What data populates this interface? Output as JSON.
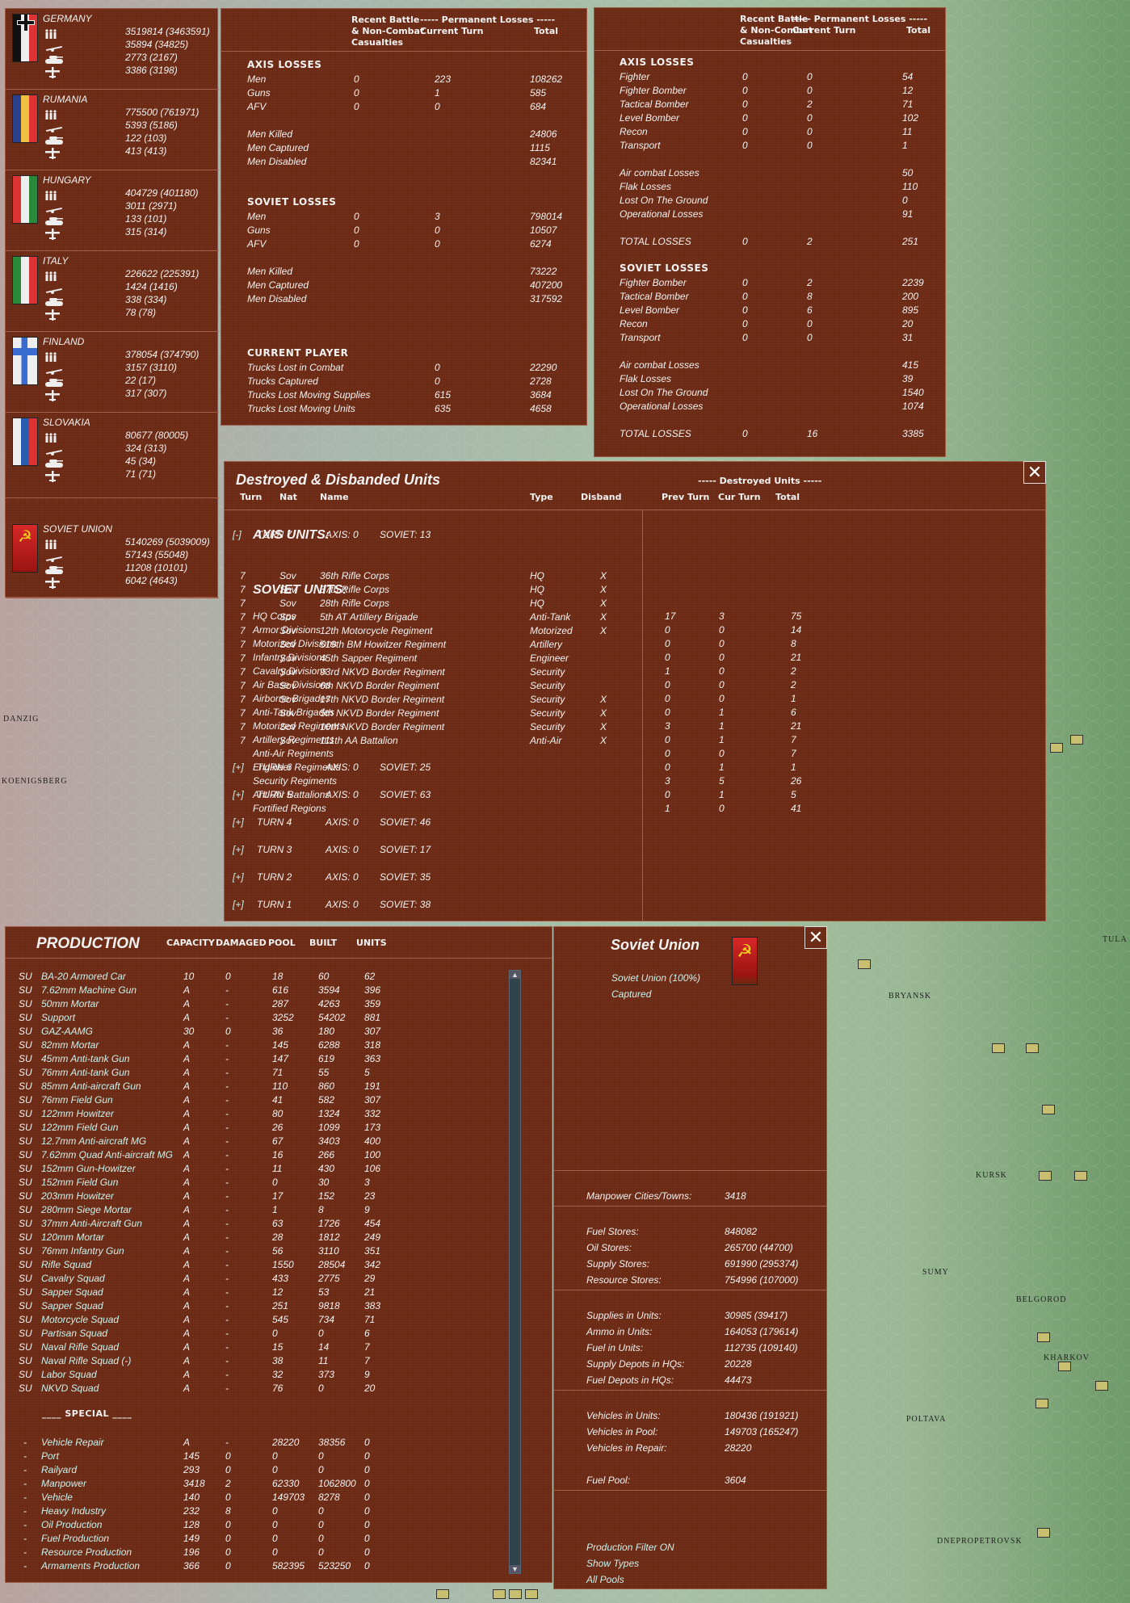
{
  "map_labels": [
    "DANZIG",
    "KOENIGSBERG",
    "BRYANSK",
    "KURSK",
    "SUMY",
    "BELGOROD",
    "KHARKOV",
    "POLTAVA",
    "DNEPROPETROVSK",
    "TULA"
  ],
  "nations": [
    {
      "name": "GERMANY",
      "flag": "germany",
      "men": "3519814 (3463591)",
      "guns": "35894 (34825)",
      "afv": "2773 (2167)",
      "air": "3386 (3198)"
    },
    {
      "name": "RUMANIA",
      "flag": "rumania",
      "men": "775500 (761971)",
      "guns": "5393 (5186)",
      "afv": "122 (103)",
      "air": "413 (413)"
    },
    {
      "name": "HUNGARY",
      "flag": "hungary",
      "men": "404729 (401180)",
      "guns": "3011 (2971)",
      "afv": "133 (101)",
      "air": "315 (314)"
    },
    {
      "name": "ITALY",
      "flag": "italy",
      "men": "226622 (225391)",
      "guns": "1424 (1416)",
      "afv": "338 (334)",
      "air": "78 (78)"
    },
    {
      "name": "FINLAND",
      "flag": "finland",
      "men": "378054 (374790)",
      "guns": "3157 (3110)",
      "afv": "22 (17)",
      "air": "317 (307)"
    },
    {
      "name": "SLOVAKIA",
      "flag": "slovakia",
      "men": "80677 (80005)",
      "guns": "324 (313)",
      "afv": "45 (34)",
      "air": "71 (71)"
    },
    {
      "name": "SOVIET UNION",
      "flag": "soviet",
      "men": "5140269 (5039009)",
      "guns": "57143 (55048)",
      "afv": "11208 (10101)",
      "air": "6042 (4643)"
    }
  ],
  "loss_headers": {
    "recent1": "Recent Battle",
    "recent2": "& Non-Combat",
    "recent3": "Casualties",
    "perm": "----- Permanent Losses -----",
    "cur": "Current Turn",
    "total": "Total"
  },
  "ground_losses": [
    {
      "title": "AXIS LOSSES",
      "groups": [
        [
          [
            "Men",
            "0",
            "223",
            "108262"
          ],
          [
            "Guns",
            "0",
            "1",
            "585"
          ],
          [
            "AFV",
            "0",
            "0",
            "684"
          ]
        ],
        [
          [
            "Men Killed",
            "",
            "",
            "24806"
          ],
          [
            "Men Captured",
            "",
            "",
            "1115"
          ],
          [
            "Men Disabled",
            "",
            "",
            "82341"
          ]
        ]
      ]
    },
    {
      "title": "SOVIET LOSSES",
      "groups": [
        [
          [
            "Men",
            "0",
            "3",
            "798014"
          ],
          [
            "Guns",
            "0",
            "0",
            "10507"
          ],
          [
            "AFV",
            "0",
            "0",
            "6274"
          ]
        ],
        [
          [
            "Men Killed",
            "",
            "",
            "73222"
          ],
          [
            "Men Captured",
            "",
            "",
            "407200"
          ],
          [
            "Men Disabled",
            "",
            "",
            "317592"
          ]
        ]
      ]
    },
    {
      "title": "CURRENT PLAYER",
      "groups": [
        [
          [
            "Trucks Lost in Combat",
            "",
            "0",
            "22290"
          ],
          [
            "Trucks Captured",
            "",
            "0",
            "2728"
          ],
          [
            "Trucks Lost Moving Supplies",
            "",
            "615",
            "3684"
          ],
          [
            "Trucks Lost Moving Units",
            "",
            "635",
            "4658"
          ]
        ]
      ]
    }
  ],
  "air_losses": [
    {
      "title": "AXIS LOSSES",
      "groups": [
        [
          [
            "Fighter",
            "0",
            "0",
            "54"
          ],
          [
            "Fighter Bomber",
            "0",
            "0",
            "12"
          ],
          [
            "Tactical Bomber",
            "0",
            "2",
            "71"
          ],
          [
            "Level Bomber",
            "0",
            "0",
            "102"
          ],
          [
            "Recon",
            "0",
            "0",
            "11"
          ],
          [
            "Transport",
            "0",
            "0",
            "1"
          ]
        ],
        [
          [
            "Air combat Losses",
            "",
            "",
            "50"
          ],
          [
            "Flak Losses",
            "",
            "",
            "110"
          ],
          [
            "Lost On The Ground",
            "",
            "",
            "0"
          ],
          [
            "Operational Losses",
            "",
            "",
            "91"
          ]
        ],
        [
          [
            "TOTAL LOSSES",
            "0",
            "2",
            "251"
          ]
        ]
      ]
    },
    {
      "title": "SOVIET LOSSES",
      "groups": [
        [
          [
            "Fighter Bomber",
            "0",
            "2",
            "2239"
          ],
          [
            "Tactical Bomber",
            "0",
            "8",
            "200"
          ],
          [
            "Level Bomber",
            "0",
            "6",
            "895"
          ],
          [
            "Recon",
            "0",
            "0",
            "20"
          ],
          [
            "Transport",
            "0",
            "0",
            "31"
          ]
        ],
        [
          [
            "Air combat Losses",
            "",
            "",
            "415"
          ],
          [
            "Flak Losses",
            "",
            "",
            "39"
          ],
          [
            "Lost On The Ground",
            "",
            "",
            "1540"
          ],
          [
            "Operational Losses",
            "",
            "",
            "1074"
          ]
        ],
        [
          [
            "TOTAL LOSSES",
            "0",
            "16",
            "3385"
          ]
        ]
      ]
    }
  ],
  "destroyed": {
    "title": "Destroyed & Disbanded Units",
    "close": "✕",
    "headers": [
      "Turn",
      "Nat",
      "Name",
      "Type",
      "Disband"
    ],
    "expanded": {
      "toggle": "[-]",
      "turn": "TURN 7",
      "axis": "AXIS: 0",
      "soviet": "SOVIET: 13"
    },
    "units": [
      [
        "7",
        "Sov",
        "36th Rifle Corps",
        "HQ",
        "X"
      ],
      [
        "7",
        "Sov",
        "37th Rifle Corps",
        "HQ",
        "X"
      ],
      [
        "7",
        "Sov",
        "28th Rifle Corps",
        "HQ",
        "X"
      ],
      [
        "7",
        "Sov",
        "5th AT Artillery Brigade",
        "Anti-Tank",
        "X"
      ],
      [
        "7",
        "Sov",
        "12th Motorcycle Regiment",
        "Motorized",
        "X"
      ],
      [
        "7",
        "Sov",
        "519th BM Howitzer Regiment",
        "Artillery",
        ""
      ],
      [
        "7",
        "Sov",
        "45th Sapper Regiment",
        "Engineer",
        ""
      ],
      [
        "7",
        "Sov",
        "93rd NKVD Border Regiment",
        "Security",
        ""
      ],
      [
        "7",
        "Sov",
        "6th NKVD Border Regiment",
        "Security",
        ""
      ],
      [
        "7",
        "Sov",
        "17th NKVD Border Regiment",
        "Security",
        "X"
      ],
      [
        "7",
        "Sov",
        "5th NKVD Border Regiment",
        "Security",
        "X"
      ],
      [
        "7",
        "Sov",
        "10th NKVD Border Regiment",
        "Security",
        "X"
      ],
      [
        "7",
        "Sov",
        "111th AA Battalion",
        "Anti-Air",
        "X"
      ]
    ],
    "collapsed": [
      {
        "toggle": "[+]",
        "turn": "TURN 6",
        "axis": "AXIS: 0",
        "soviet": "SOVIET: 25"
      },
      {
        "toggle": "[+]",
        "turn": "TURN 5",
        "axis": "AXIS: 0",
        "soviet": "SOVIET: 63"
      },
      {
        "toggle": "[+]",
        "turn": "TURN 4",
        "axis": "AXIS: 0",
        "soviet": "SOVIET: 46"
      },
      {
        "toggle": "[+]",
        "turn": "TURN 3",
        "axis": "AXIS: 0",
        "soviet": "SOVIET: 17"
      },
      {
        "toggle": "[+]",
        "turn": "TURN 2",
        "axis": "AXIS: 0",
        "soviet": "SOVIET: 35"
      },
      {
        "toggle": "[+]",
        "turn": "TURN 1",
        "axis": "AXIS: 0",
        "soviet": "SOVIET: 38"
      }
    ],
    "summary_header": "----- Destroyed Units -----",
    "summary_cols": [
      "Prev Turn",
      "Cur Turn",
      "Total"
    ],
    "axis_title": "AXIS UNITS:",
    "soviet_title": "SOVIET UNITS:",
    "soviet_rows": [
      [
        "HQ Corps",
        "17",
        "3",
        "75"
      ],
      [
        "Armor Divisions",
        "0",
        "0",
        "14"
      ],
      [
        "Motorized Divisions",
        "0",
        "0",
        "8"
      ],
      [
        "Infantry Divisions",
        "0",
        "0",
        "21"
      ],
      [
        "Cavalry Divisions",
        "1",
        "0",
        "2"
      ],
      [
        "Air Base Divisions",
        "0",
        "0",
        "2"
      ],
      [
        "Airborne Brigades",
        "0",
        "0",
        "1"
      ],
      [
        "Anti-Tank Brigades",
        "0",
        "1",
        "6"
      ],
      [
        "Motorized Regiments",
        "3",
        "1",
        "21"
      ],
      [
        "Artillery Regiments",
        "0",
        "1",
        "7"
      ],
      [
        "Anti-Air Regiments",
        "0",
        "0",
        "7"
      ],
      [
        "Engineer Regiments",
        "0",
        "1",
        "1"
      ],
      [
        "Security Regiments",
        "3",
        "5",
        "26"
      ],
      [
        "Anti-Air Battalions",
        "0",
        "1",
        "5"
      ],
      [
        "Fortified Regions",
        "1",
        "0",
        "41"
      ]
    ]
  },
  "production": {
    "title": "PRODUCTION",
    "headers": [
      "CAPACITY",
      "DAMAGED",
      "POOL",
      "BUILT",
      "UNITS"
    ],
    "rows": [
      [
        "SU",
        "BA-20 Armored Car",
        "10",
        "0",
        "18",
        "60",
        "62"
      ],
      [
        "SU",
        "7.62mm Machine Gun",
        "A",
        "-",
        "616",
        "3594",
        "396"
      ],
      [
        "SU",
        "50mm Mortar",
        "A",
        "-",
        "287",
        "4263",
        "359"
      ],
      [
        "SU",
        "Support",
        "A",
        "-",
        "3252",
        "54202",
        "881"
      ],
      [
        "SU",
        "GAZ-AAMG",
        "30",
        "0",
        "36",
        "180",
        "307"
      ],
      [
        "SU",
        "82mm Mortar",
        "A",
        "-",
        "145",
        "6288",
        "318"
      ],
      [
        "SU",
        "45mm Anti-tank Gun",
        "A",
        "-",
        "147",
        "619",
        "363"
      ],
      [
        "SU",
        "76mm Anti-tank Gun",
        "A",
        "-",
        "71",
        "55",
        "5"
      ],
      [
        "SU",
        "85mm Anti-aircraft Gun",
        "A",
        "-",
        "110",
        "860",
        "191"
      ],
      [
        "SU",
        "76mm Field Gun",
        "A",
        "-",
        "41",
        "582",
        "307"
      ],
      [
        "SU",
        "122mm Howitzer",
        "A",
        "-",
        "80",
        "1324",
        "332"
      ],
      [
        "SU",
        "122mm Field Gun",
        "A",
        "-",
        "26",
        "1099",
        "173"
      ],
      [
        "SU",
        "12.7mm Anti-aircraft MG",
        "A",
        "-",
        "67",
        "3403",
        "400"
      ],
      [
        "SU",
        "7.62mm Quad Anti-aircraft MG",
        "A",
        "-",
        "16",
        "266",
        "100"
      ],
      [
        "SU",
        "152mm Gun-Howitzer",
        "A",
        "-",
        "11",
        "430",
        "106"
      ],
      [
        "SU",
        "152mm Field Gun",
        "A",
        "-",
        "0",
        "30",
        "3"
      ],
      [
        "SU",
        "203mm Howitzer",
        "A",
        "-",
        "17",
        "152",
        "23"
      ],
      [
        "SU",
        "280mm Siege Mortar",
        "A",
        "-",
        "1",
        "8",
        "9"
      ],
      [
        "SU",
        "37mm Anti-Aircraft Gun",
        "A",
        "-",
        "63",
        "1726",
        "454"
      ],
      [
        "SU",
        "120mm Mortar",
        "A",
        "-",
        "28",
        "1812",
        "249"
      ],
      [
        "SU",
        "76mm Infantry Gun",
        "A",
        "-",
        "56",
        "3110",
        "351"
      ],
      [
        "SU",
        "Rifle Squad",
        "A",
        "-",
        "1550",
        "28504",
        "342"
      ],
      [
        "SU",
        "Cavalry Squad",
        "A",
        "-",
        "433",
        "2775",
        "29"
      ],
      [
        "SU",
        "Sapper Squad",
        "A",
        "-",
        "12",
        "53",
        "21"
      ],
      [
        "SU",
        "Sapper Squad",
        "A",
        "-",
        "251",
        "9818",
        "383"
      ],
      [
        "SU",
        "Motorcycle Squad",
        "A",
        "-",
        "545",
        "734",
        "71"
      ],
      [
        "SU",
        "Partisan Squad",
        "A",
        "-",
        "0",
        "0",
        "6"
      ],
      [
        "SU",
        "Naval Rifle Squad",
        "A",
        "-",
        "15",
        "14",
        "7"
      ],
      [
        "SU",
        "Naval Rifle Squad (-)",
        "A",
        "-",
        "38",
        "11",
        "7"
      ],
      [
        "SU",
        "Labor Squad",
        "A",
        "-",
        "32",
        "373",
        "9"
      ],
      [
        "SU",
        "NKVD Squad",
        "A",
        "-",
        "76",
        "0",
        "20"
      ]
    ],
    "special_title": "____ SPECIAL ____",
    "special_rows": [
      [
        "-",
        "Vehicle Repair",
        "A",
        "-",
        "28220",
        "38356",
        "0"
      ],
      [
        "-",
        "Port",
        "145",
        "0",
        "0",
        "0",
        "0"
      ],
      [
        "-",
        "Railyard",
        "293",
        "0",
        "0",
        "0",
        "0"
      ],
      [
        "-",
        "Manpower",
        "3418",
        "2",
        "62330",
        "1062800",
        "0"
      ],
      [
        "-",
        "Vehicle",
        "140",
        "0",
        "149703",
        "8278",
        "0"
      ],
      [
        "-",
        "Heavy Industry",
        "232",
        "8",
        "0",
        "0",
        "0"
      ],
      [
        "-",
        "Oil Production",
        "128",
        "0",
        "0",
        "0",
        "0"
      ],
      [
        "-",
        "Fuel Production",
        "149",
        "0",
        "0",
        "0",
        "0"
      ],
      [
        "-",
        "Resource Production",
        "196",
        "0",
        "0",
        "0",
        "0"
      ],
      [
        "-",
        "Armaments Production",
        "366",
        "0",
        "582395",
        "523250",
        "0"
      ]
    ],
    "scroll_up": "▲",
    "scroll_down": "▼"
  },
  "nation_panel": {
    "title": "Soviet Union",
    "close": "✕",
    "owner": "Soviet Union  (100%)",
    "status": "Captured",
    "groups": [
      [
        [
          "Manpower Cities/Towns:",
          "3418"
        ]
      ],
      [
        [
          "Fuel Stores:",
          "848082"
        ],
        [
          "Oil Stores:",
          "265700 (44700)"
        ],
        [
          "Supply Stores:",
          "691990 (295374)"
        ],
        [
          "Resource Stores:",
          "754996 (107000)"
        ]
      ],
      [
        [
          "Supplies in Units:",
          "30985 (39417)"
        ],
        [
          "Ammo in Units:",
          "164053 (179614)"
        ],
        [
          "Fuel in Units:",
          "112735 (109140)"
        ],
        [
          "Supply Depots in HQs:",
          "20228"
        ],
        [
          "Fuel Depots in HQs:",
          "44473"
        ]
      ],
      [
        [
          "Vehicles in Units:",
          "180436 (191921)"
        ],
        [
          "Vehicles in Pool:",
          "149703 (165247)"
        ],
        [
          "Vehicles in Repair:",
          "28220"
        ],
        [
          "",
          ""
        ],
        [
          "Fuel Pool:",
          "3604"
        ]
      ]
    ],
    "links": [
      "Production Filter ON",
      "Show Types",
      "All Pools"
    ]
  },
  "colors": {
    "panel": "#6b2913",
    "text": "#f2f2f2",
    "link": "#c9f2ee",
    "soviet_red": "#c8201e",
    "soviet_gold": "#f2d21a"
  }
}
